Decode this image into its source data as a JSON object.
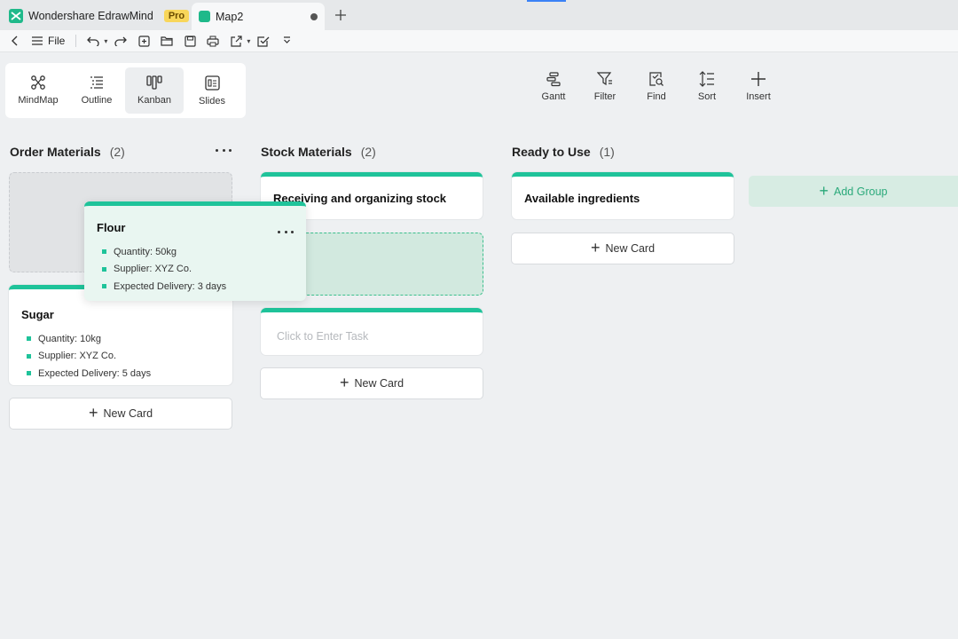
{
  "app": {
    "name": "Wondershare EdrawMind",
    "badge": "Pro",
    "doc_tab": "Map2"
  },
  "quickbar": {
    "file_label": "File"
  },
  "views": [
    {
      "label": "MindMap",
      "icon": "mindmap-icon"
    },
    {
      "label": "Outline",
      "icon": "outline-icon"
    },
    {
      "label": "Kanban",
      "icon": "kanban-icon",
      "active": true
    },
    {
      "label": "Slides",
      "icon": "slides-icon"
    }
  ],
  "tools": [
    {
      "label": "Gantt",
      "icon": "gantt-icon"
    },
    {
      "label": "Filter",
      "icon": "filter-icon"
    },
    {
      "label": "Find",
      "icon": "find-icon"
    },
    {
      "label": "Sort",
      "icon": "sort-icon"
    },
    {
      "label": "Insert",
      "icon": "insert-icon"
    }
  ],
  "columns": [
    {
      "title": "Order Materials",
      "count": "(2)"
    },
    {
      "title": "Stock Materials",
      "count": "(2)"
    },
    {
      "title": "Ready to Use",
      "count": "(1)"
    }
  ],
  "cards": {
    "sugar": {
      "title": "Sugar",
      "bullets": [
        "Quantity: 10kg",
        "Supplier: XYZ Co.",
        "Expected Delivery: 5 days"
      ]
    },
    "flour": {
      "title": "Flour",
      "bullets": [
        "Quantity: 50kg",
        "Supplier: XYZ Co.",
        "Expected Delivery: 3 days"
      ]
    },
    "receiving": {
      "title": "Receiving and organizing stock"
    },
    "new_task_placeholder": "Click to Enter Task",
    "available": {
      "title": "Available ingredients"
    }
  },
  "new_card_label": "New Card",
  "add_group_label": "Add Group",
  "colors": {
    "accent": "#1fc39a",
    "badge": "#f8d65a",
    "add_group_text": "#2aa97a"
  }
}
